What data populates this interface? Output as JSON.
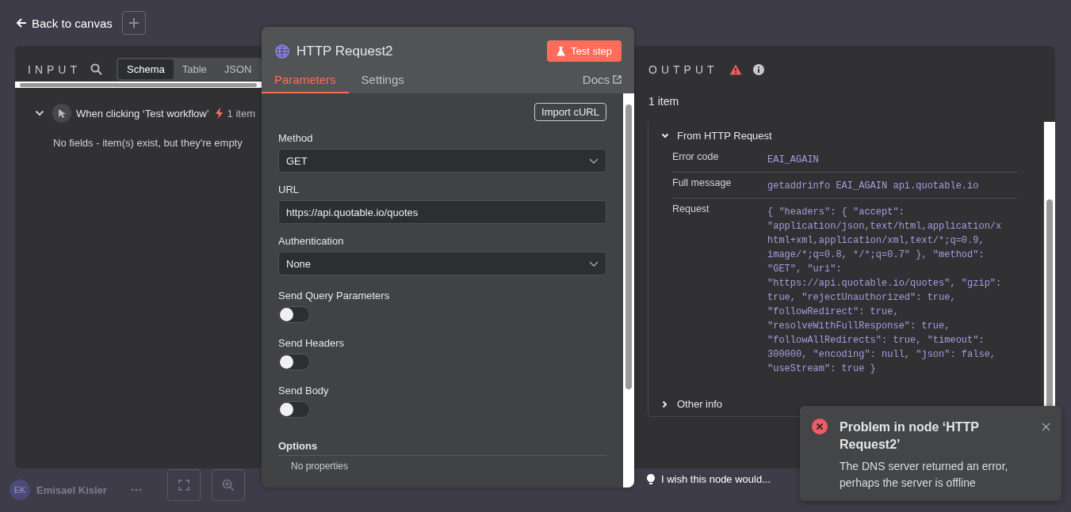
{
  "top_bar": {
    "back_label": "Back to canvas"
  },
  "input": {
    "title": "INPUT",
    "view_tabs": [
      {
        "label": "Schema",
        "selected": true
      },
      {
        "label": "Table",
        "selected": false
      },
      {
        "label": "JSON",
        "selected": false
      }
    ],
    "node": {
      "name": "When clicking ‘Test workflow’",
      "count": "1 item",
      "expanded": true
    },
    "empty_message": "No fields - item(s) exist, but they're empty"
  },
  "node": {
    "title": "HTTP Request2",
    "test_button": "Test step",
    "tabs": [
      {
        "label": "Parameters",
        "selected": true
      },
      {
        "label": "Settings",
        "selected": false
      }
    ],
    "docs": "Docs",
    "import_button": "Import cURL",
    "fields": [
      {
        "kind": "select",
        "label": "Method",
        "value": "GET"
      },
      {
        "kind": "text",
        "label": "URL",
        "value": "https://api.quotable.io/quotes"
      },
      {
        "kind": "select",
        "label": "Authentication",
        "value": "None"
      },
      {
        "kind": "toggle",
        "label": "Send Query Parameters",
        "on": false
      },
      {
        "kind": "toggle",
        "label": "Send Headers",
        "on": false
      },
      {
        "kind": "toggle",
        "label": "Send Body",
        "on": false
      }
    ],
    "options": {
      "title": "Options",
      "empty": "No properties"
    }
  },
  "output": {
    "title": "OUTPUT",
    "count": "1 item",
    "sections": [
      {
        "title": "From HTTP Request",
        "expanded": true,
        "rows": [
          {
            "label": "Error code",
            "value": "EAI_AGAIN"
          },
          {
            "label": "Full message",
            "value": "getaddrinfo EAI_AGAIN api.quotable.io"
          },
          {
            "label": "Request",
            "value": "{ \"headers\": { \"accept\": \"application/json,text/html,application/xhtml+xml,application/xml,text/*;q=0.9, image/*;q=0.8, */*;q=0.7\" }, \"method\": \"GET\", \"uri\": \"https://api.quotable.io/quotes\", \"gzip\": true, \"rejectUnauthorized\": true, \"followRedirect\": true, \"resolveWithFullResponse\": true, \"followAllRedirects\": true, \"timeout\": 300000, \"encoding\": null, \"json\": false, \"useStream\": true }"
          }
        ]
      },
      {
        "title": "Other info",
        "expanded": false
      }
    ]
  },
  "toast": {
    "title": "Problem in node ‘HTTP Request2’",
    "message": "The DNS server returned an error, perhaps the server is offline"
  },
  "user": {
    "initials": "EK",
    "name": "Emisael Kisler"
  },
  "feedback": "I wish this node would..."
}
